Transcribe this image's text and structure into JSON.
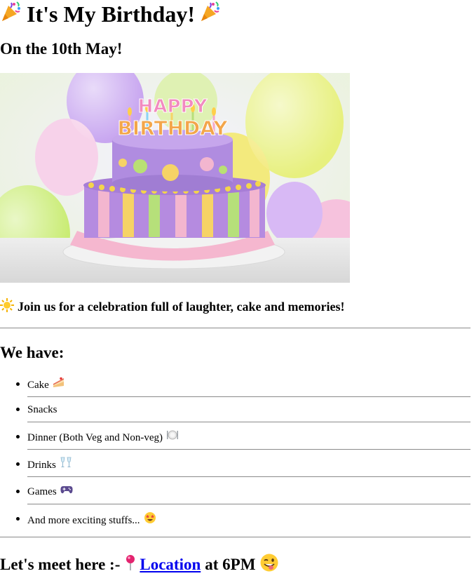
{
  "header": {
    "title": "It's My Birthday!",
    "title_icon_left": "party-popper-icon",
    "title_icon_right": "party-popper-icon",
    "subtitle": "On the 10th May!"
  },
  "hero_image": {
    "cake_sign_line_1": "HAPPY",
    "cake_sign_line_2": "BIRTHDAY"
  },
  "invite": {
    "icon": "sun-icon",
    "text": "Join us for a celebration full of laughter, cake and memories!"
  },
  "menu": {
    "heading": "We have:",
    "items": [
      {
        "label": "Cake",
        "icon": "cake-slice-icon"
      },
      {
        "label": "Snacks",
        "icon": ""
      },
      {
        "label": "Dinner (Both Veg and Non-veg)",
        "icon": "plate-icon"
      },
      {
        "label": "Drinks",
        "icon": "champagne-glasses-icon"
      },
      {
        "label": "Games",
        "icon": "game-controller-icon"
      },
      {
        "label": "And more exciting stuffs...",
        "icon": "star-struck-face-icon"
      }
    ]
  },
  "meet": {
    "prefix": "Let's meet here :-",
    "location_icon": "pushpin-icon",
    "location_link": "Location",
    "suffix": "at 6PM",
    "end_icon": "winking-tongue-face-icon"
  },
  "colors": {
    "link": "#0000ee",
    "rule": "#8a8a8a"
  }
}
